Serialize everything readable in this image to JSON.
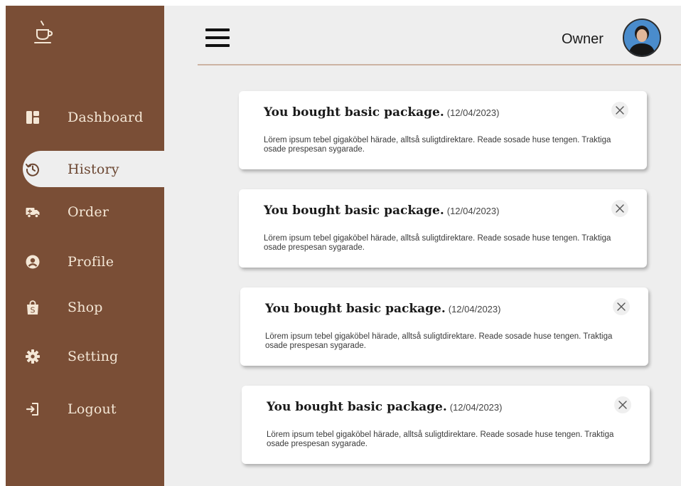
{
  "user": {
    "name": "Owner"
  },
  "nav": {
    "items": [
      {
        "label": "Dashboard",
        "icon": "dashboard-icon"
      },
      {
        "label": "History",
        "icon": "history-icon",
        "active": true
      },
      {
        "label": "Order",
        "icon": "truck-icon"
      },
      {
        "label": "Profile",
        "icon": "user-circle-icon"
      },
      {
        "label": "Shop",
        "icon": "shopping-bag-icon"
      },
      {
        "label": "Setting",
        "icon": "gear-icon"
      },
      {
        "label": "Logout",
        "icon": "logout-icon"
      }
    ]
  },
  "notifications": [
    {
      "title": "You bought basic package.",
      "date": "(12/04/2023)",
      "body": "Lörem ipsum tebel gigaköbel härade, alltså suligtdirektare. Reade sosade huse tengen. Traktiga osade prespesan sygarade."
    },
    {
      "title": "You bought basic package.",
      "date": "(12/04/2023)",
      "body": "Lörem ipsum tebel gigaköbel härade, alltså suligtdirektare. Reade sosade huse tengen. Traktiga osade prespesan sygarade."
    },
    {
      "title": "You bought basic package.",
      "date": "(12/04/2023)",
      "body": "Lörem ipsum tebel gigaköbel härade, alltså suligtdirektare. Reade sosade huse tengen. Traktiga osade prespesan sygarade."
    },
    {
      "title": "You bought basic package.",
      "date": "(12/04/2023)",
      "body": "Lörem ipsum tebel gigaköbel härade, alltså suligtdirektare. Reade sosade huse tengen. Traktiga osade prespesan sygarade."
    }
  ],
  "colors": {
    "sidebar": "#7a4e36",
    "sidebar_text": "#f4e7d6",
    "background": "#eeeeee",
    "divider": "#cdb3a3"
  }
}
